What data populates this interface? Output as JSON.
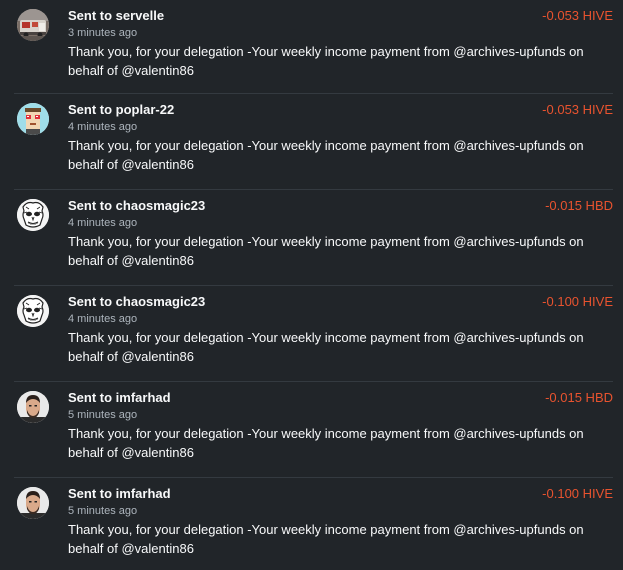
{
  "transactions": [
    {
      "avatar_icon": "servelle-avatar-icon",
      "title": "Sent to servelle",
      "time": "3 minutes ago",
      "amount": "-0.053 HIVE",
      "memo": "Thank you, for your delegation -Your weekly income payment from @archives-upfunds on behalf of @valentin86"
    },
    {
      "avatar_icon": "poplar-22-avatar-icon",
      "title": "Sent to poplar-22",
      "time": "4 minutes ago",
      "amount": "-0.053 HIVE",
      "memo": "Thank you, for your delegation -Your weekly income payment from @archives-upfunds on behalf of @valentin86"
    },
    {
      "avatar_icon": "chaosmagic23-avatar-icon",
      "title": "Sent to chaosmagic23",
      "time": "4 minutes ago",
      "amount": "-0.015 HBD",
      "memo": "Thank you, for your delegation -Your weekly income payment from @archives-upfunds on behalf of @valentin86"
    },
    {
      "avatar_icon": "chaosmagic23-avatar-icon",
      "title": "Sent to chaosmagic23",
      "time": "4 minutes ago",
      "amount": "-0.100 HIVE",
      "memo": "Thank you, for your delegation -Your weekly income payment from @archives-upfunds on behalf of @valentin86"
    },
    {
      "avatar_icon": "imfarhad-avatar-icon",
      "title": "Sent to imfarhad",
      "time": "5 minutes ago",
      "amount": "-0.015 HBD",
      "memo": "Thank you, for your delegation -Your weekly income payment from @archives-upfunds on behalf of @valentin86"
    },
    {
      "avatar_icon": "imfarhad-avatar-icon",
      "title": "Sent to imfarhad",
      "time": "5 minutes ago",
      "amount": "-0.100 HIVE",
      "memo": "Thank you, for your delegation -Your weekly income payment from @archives-upfunds on behalf of @valentin86"
    }
  ],
  "colors": {
    "background": "#212529",
    "text": "#f8f9fa",
    "muted": "#adb5bd",
    "amount": "#e8532f",
    "divider": "#343a40"
  }
}
